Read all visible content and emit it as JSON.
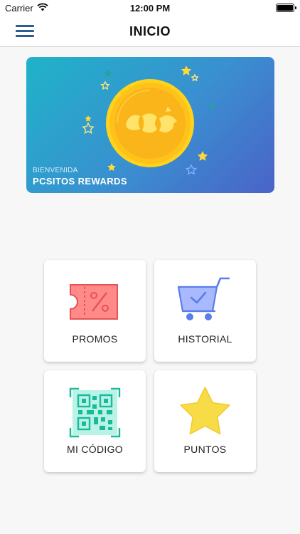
{
  "status_bar": {
    "carrier": "Carrier",
    "time": "12:00 PM"
  },
  "nav": {
    "title": "INICIO",
    "menu_icon": "hamburger-menu-icon"
  },
  "banner": {
    "welcome": "BIENVENIDA",
    "brand": "PCSITOS REWARDS",
    "image": "gold-coin-illustration"
  },
  "menu": [
    {
      "label": "PROMOS",
      "icon": "ticket-percent-icon"
    },
    {
      "label": "HISTORIAL",
      "icon": "shopping-cart-check-icon"
    },
    {
      "label": "MI CÓDIGO",
      "icon": "qr-code-icon"
    },
    {
      "label": "PUNTOS",
      "icon": "star-icon"
    }
  ],
  "colors": {
    "accent": "#2f5b8f",
    "promos": "#f26b6b",
    "historial": "#6d8ff0",
    "codigo": "#1ec7a8",
    "puntos": "#f7dc47"
  }
}
